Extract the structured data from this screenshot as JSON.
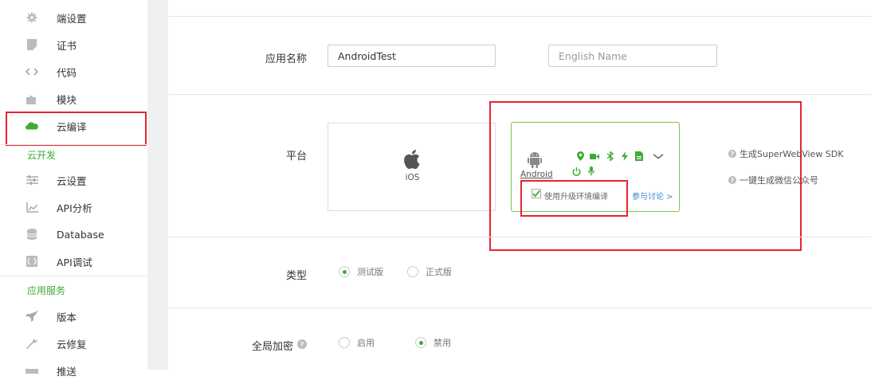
{
  "sidebar": {
    "items_top": [
      {
        "label": "端设置",
        "icon": "gear-icon"
      },
      {
        "label": "证书",
        "icon": "certificate-icon"
      },
      {
        "label": "代码",
        "icon": "code-icon"
      },
      {
        "label": "模块",
        "icon": "puzzle-icon"
      },
      {
        "label": "云编译",
        "icon": "cloud-icon"
      }
    ],
    "section_cloud_dev": "云开发",
    "items_cloud_dev": [
      {
        "label": "云设置",
        "icon": "sliders-icon"
      },
      {
        "label": "API分析",
        "icon": "chart-icon"
      },
      {
        "label": "Database",
        "icon": "database-icon"
      },
      {
        "label": "API调试",
        "icon": "debug-icon"
      }
    ],
    "section_app_services": "应用服务",
    "items_app_services": [
      {
        "label": "版本",
        "icon": "rocket-icon"
      },
      {
        "label": "云修复",
        "icon": "wrench-icon"
      },
      {
        "label": "推送",
        "icon": "push-icon"
      }
    ]
  },
  "form": {
    "app_name_label": "应用名称",
    "app_name_value": "AndroidTest",
    "english_name_placeholder": "English Name",
    "platform_label": "平台",
    "ios_label": "iOS",
    "android_label": "Android",
    "upgrade_env_label": "使用升级环境编译",
    "upgrade_env_checked": true,
    "discuss_link": "参与讨论 >",
    "help_super_sdk": "生成SuperWebView SDK",
    "help_wechat": "一键生成微信公众号",
    "type_label": "类型",
    "type_test": "测试版",
    "type_release": "正式版",
    "type_selected": "测试版",
    "encrypt_label": "全局加密",
    "encrypt_on": "启用",
    "encrypt_off": "禁用",
    "encrypt_selected": "禁用"
  },
  "colors": {
    "accent_green": "#3faa35",
    "highlight_red": "#e8232f",
    "link_blue": "#3a86c8"
  }
}
